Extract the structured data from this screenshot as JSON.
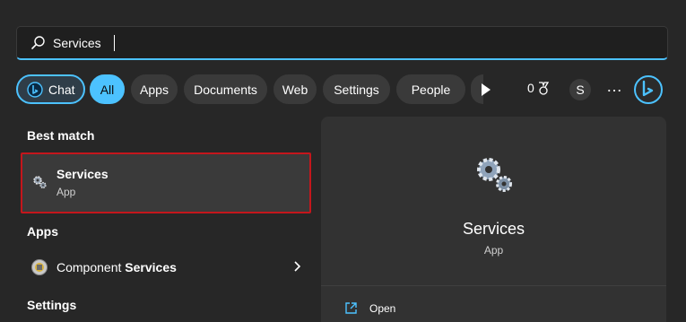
{
  "search": {
    "value": "Services",
    "placeholder": ""
  },
  "filters": {
    "chat": "Chat",
    "all": "All",
    "apps": "Apps",
    "documents": "Documents",
    "web": "Web",
    "settings": "Settings",
    "people": "People",
    "points": "0",
    "avatar_initial": "S",
    "more": "…"
  },
  "left": {
    "best_match_heading": "Best match",
    "best_match": {
      "title": "Services",
      "subtitle": "App",
      "icon": "gears-icon"
    },
    "apps_heading": "Apps",
    "apps_items": [
      {
        "label_prefix": "Component ",
        "label_bold": "Services",
        "icon": "component-services-icon"
      }
    ],
    "settings_heading": "Settings"
  },
  "preview": {
    "title": "Services",
    "subtitle": "App",
    "actions": [
      {
        "label": "Open",
        "icon": "open-external-icon"
      }
    ]
  },
  "colors": {
    "accent": "#4cc2ff",
    "highlight_border": "#c4161c",
    "background": "#272727",
    "panel": "#323232"
  }
}
